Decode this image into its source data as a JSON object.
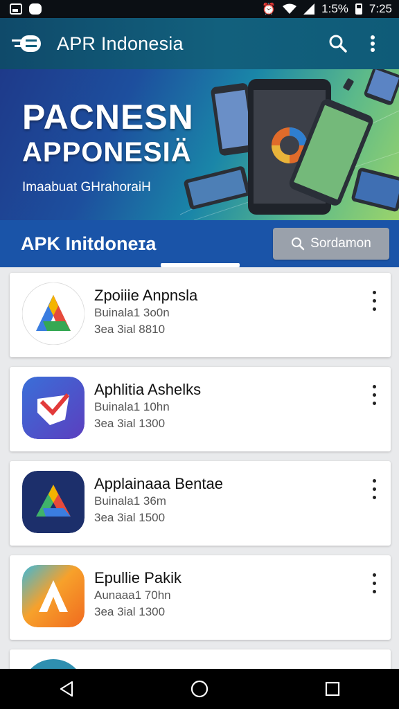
{
  "status_bar": {
    "battery_text": "1:5%",
    "time": "7:25"
  },
  "app_bar": {
    "title": "APR Indonesia"
  },
  "hero": {
    "title": "PACNESN",
    "subtitle": "APPONESIÄ",
    "tagline": "Imaabuat GHrahoraiH"
  },
  "section": {
    "title": "APK Initdoneɪa",
    "search_label": "Sordamon"
  },
  "apps": [
    {
      "name": "Zpoiiie Anpnsla",
      "line1": "Buinala1 3o0n",
      "line2": "3ea 3ial  8810"
    },
    {
      "name": "Aphlitia Ashelks",
      "line1": "Buinala1 10hn",
      "line2": "3ea 3ial 1300"
    },
    {
      "name": "Applainaaa Bentae",
      "line1": "Buinala1 36m",
      "line2": "3ea 3ial 1500"
    },
    {
      "name": "Epullie Pakik",
      "line1": "Aunaaa1 70hn",
      "line2": "3ea 3ial 1300"
    }
  ]
}
